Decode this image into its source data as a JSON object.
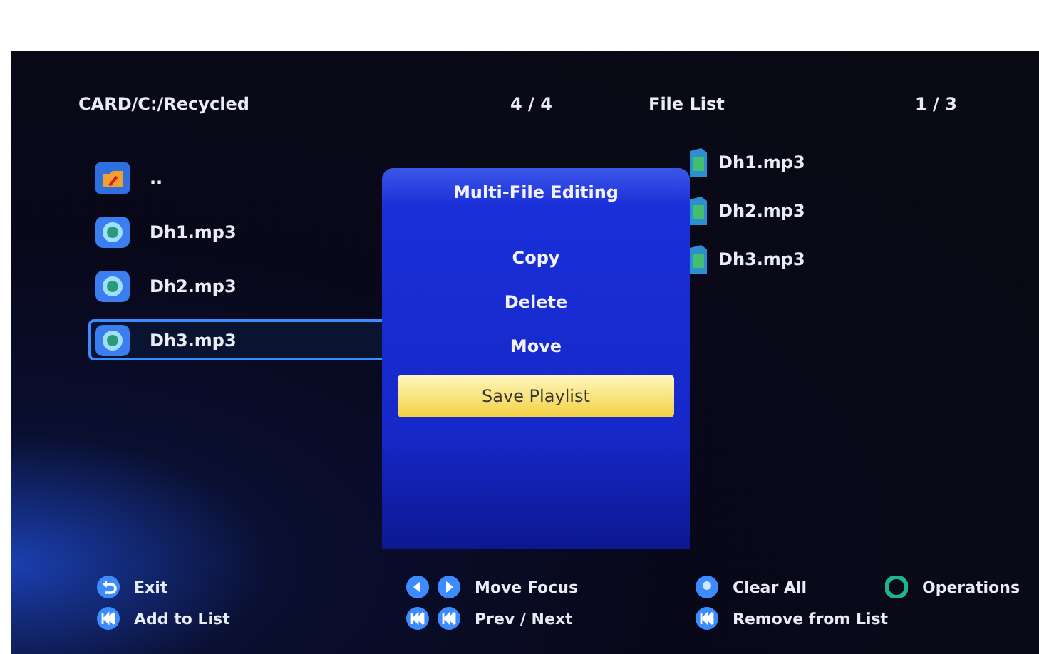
{
  "header": {
    "path": "CARD/C:/Recycled",
    "path_count": "4 / 4",
    "list_title": "File List",
    "list_count": "1 / 3"
  },
  "browser_items": [
    {
      "kind": "folder-up",
      "label": "..",
      "selected": false
    },
    {
      "kind": "audio",
      "label": "Dh1.mp3",
      "selected": false
    },
    {
      "kind": "audio",
      "label": "Dh2.mp3",
      "selected": false
    },
    {
      "kind": "audio",
      "label": "Dh3.mp3",
      "selected": true
    }
  ],
  "file_list": [
    {
      "label": "Dh1.mp3"
    },
    {
      "label": "Dh2.mp3"
    },
    {
      "label": "Dh3.mp3"
    }
  ],
  "menu": {
    "title": "Multi-File Editing",
    "items": [
      {
        "label": "Copy",
        "selected": false
      },
      {
        "label": "Delete",
        "selected": false
      },
      {
        "label": "Move",
        "selected": false
      },
      {
        "label": "Save Playlist",
        "selected": true
      }
    ]
  },
  "legend": [
    {
      "keys": [
        {
          "kind": "return"
        }
      ],
      "label": "Exit"
    },
    {
      "keys": [
        {
          "kind": "left"
        },
        {
          "kind": "right"
        }
      ],
      "label": "Move Focus"
    },
    {
      "keys": [
        {
          "kind": "dot"
        }
      ],
      "label": "Clear All"
    },
    {
      "keys": [
        {
          "kind": "ring"
        }
      ],
      "label": "Operations"
    },
    {
      "keys": [
        {
          "kind": "skip"
        }
      ],
      "label": "Add to List"
    },
    {
      "keys": [
        {
          "kind": "skip"
        },
        {
          "kind": "skip"
        }
      ],
      "label": "Prev / Next"
    },
    {
      "keys": [
        {
          "kind": "skip"
        }
      ],
      "label": "Remove from List"
    }
  ]
}
